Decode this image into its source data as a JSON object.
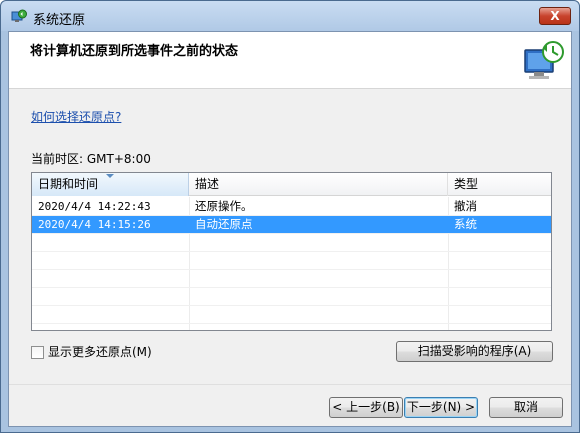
{
  "window": {
    "title": "系统还原",
    "close_label": "X"
  },
  "header": {
    "heading": "将计算机还原到所选事件之前的状态"
  },
  "help_link": "如何选择还原点?",
  "timezone": "当前时区: GMT+8:00",
  "table": {
    "columns": [
      "日期和时间",
      "描述",
      "类型"
    ],
    "rows": [
      {
        "datetime": "2020/4/4 14:22:43",
        "description": "还原操作。",
        "type": "撤消",
        "selected": false
      },
      {
        "datetime": "2020/4/4 14:15:26",
        "description": "自动还原点",
        "type": "系统",
        "selected": true
      }
    ]
  },
  "show_more_label": "显示更多还原点(M)",
  "buttons": {
    "scan": "扫描受影响的程序(A)",
    "back": "< 上一步(B)",
    "next": "下一步(N) >",
    "cancel": "取消"
  },
  "colors": {
    "selection": "#3399ff",
    "link": "#1c4fad",
    "close": "#c8432d"
  }
}
